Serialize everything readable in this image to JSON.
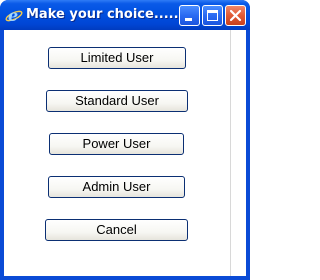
{
  "window": {
    "title": "Make your choice........",
    "app_icon": "ie-logo-icon",
    "controls": {
      "minimize_icon": "minimize-icon",
      "maximize_icon": "maximize-icon",
      "close_icon": "close-icon"
    }
  },
  "buttons": [
    {
      "label": "Limited User"
    },
    {
      "label": "Standard User"
    },
    {
      "label": "Power User"
    },
    {
      "label": "Admin User"
    },
    {
      "label": "Cancel"
    }
  ],
  "colors": {
    "titlebar": "#0050e0",
    "close_button": "#e05a35",
    "button_border": "#0b2f73",
    "client_background": "#ffffff"
  }
}
